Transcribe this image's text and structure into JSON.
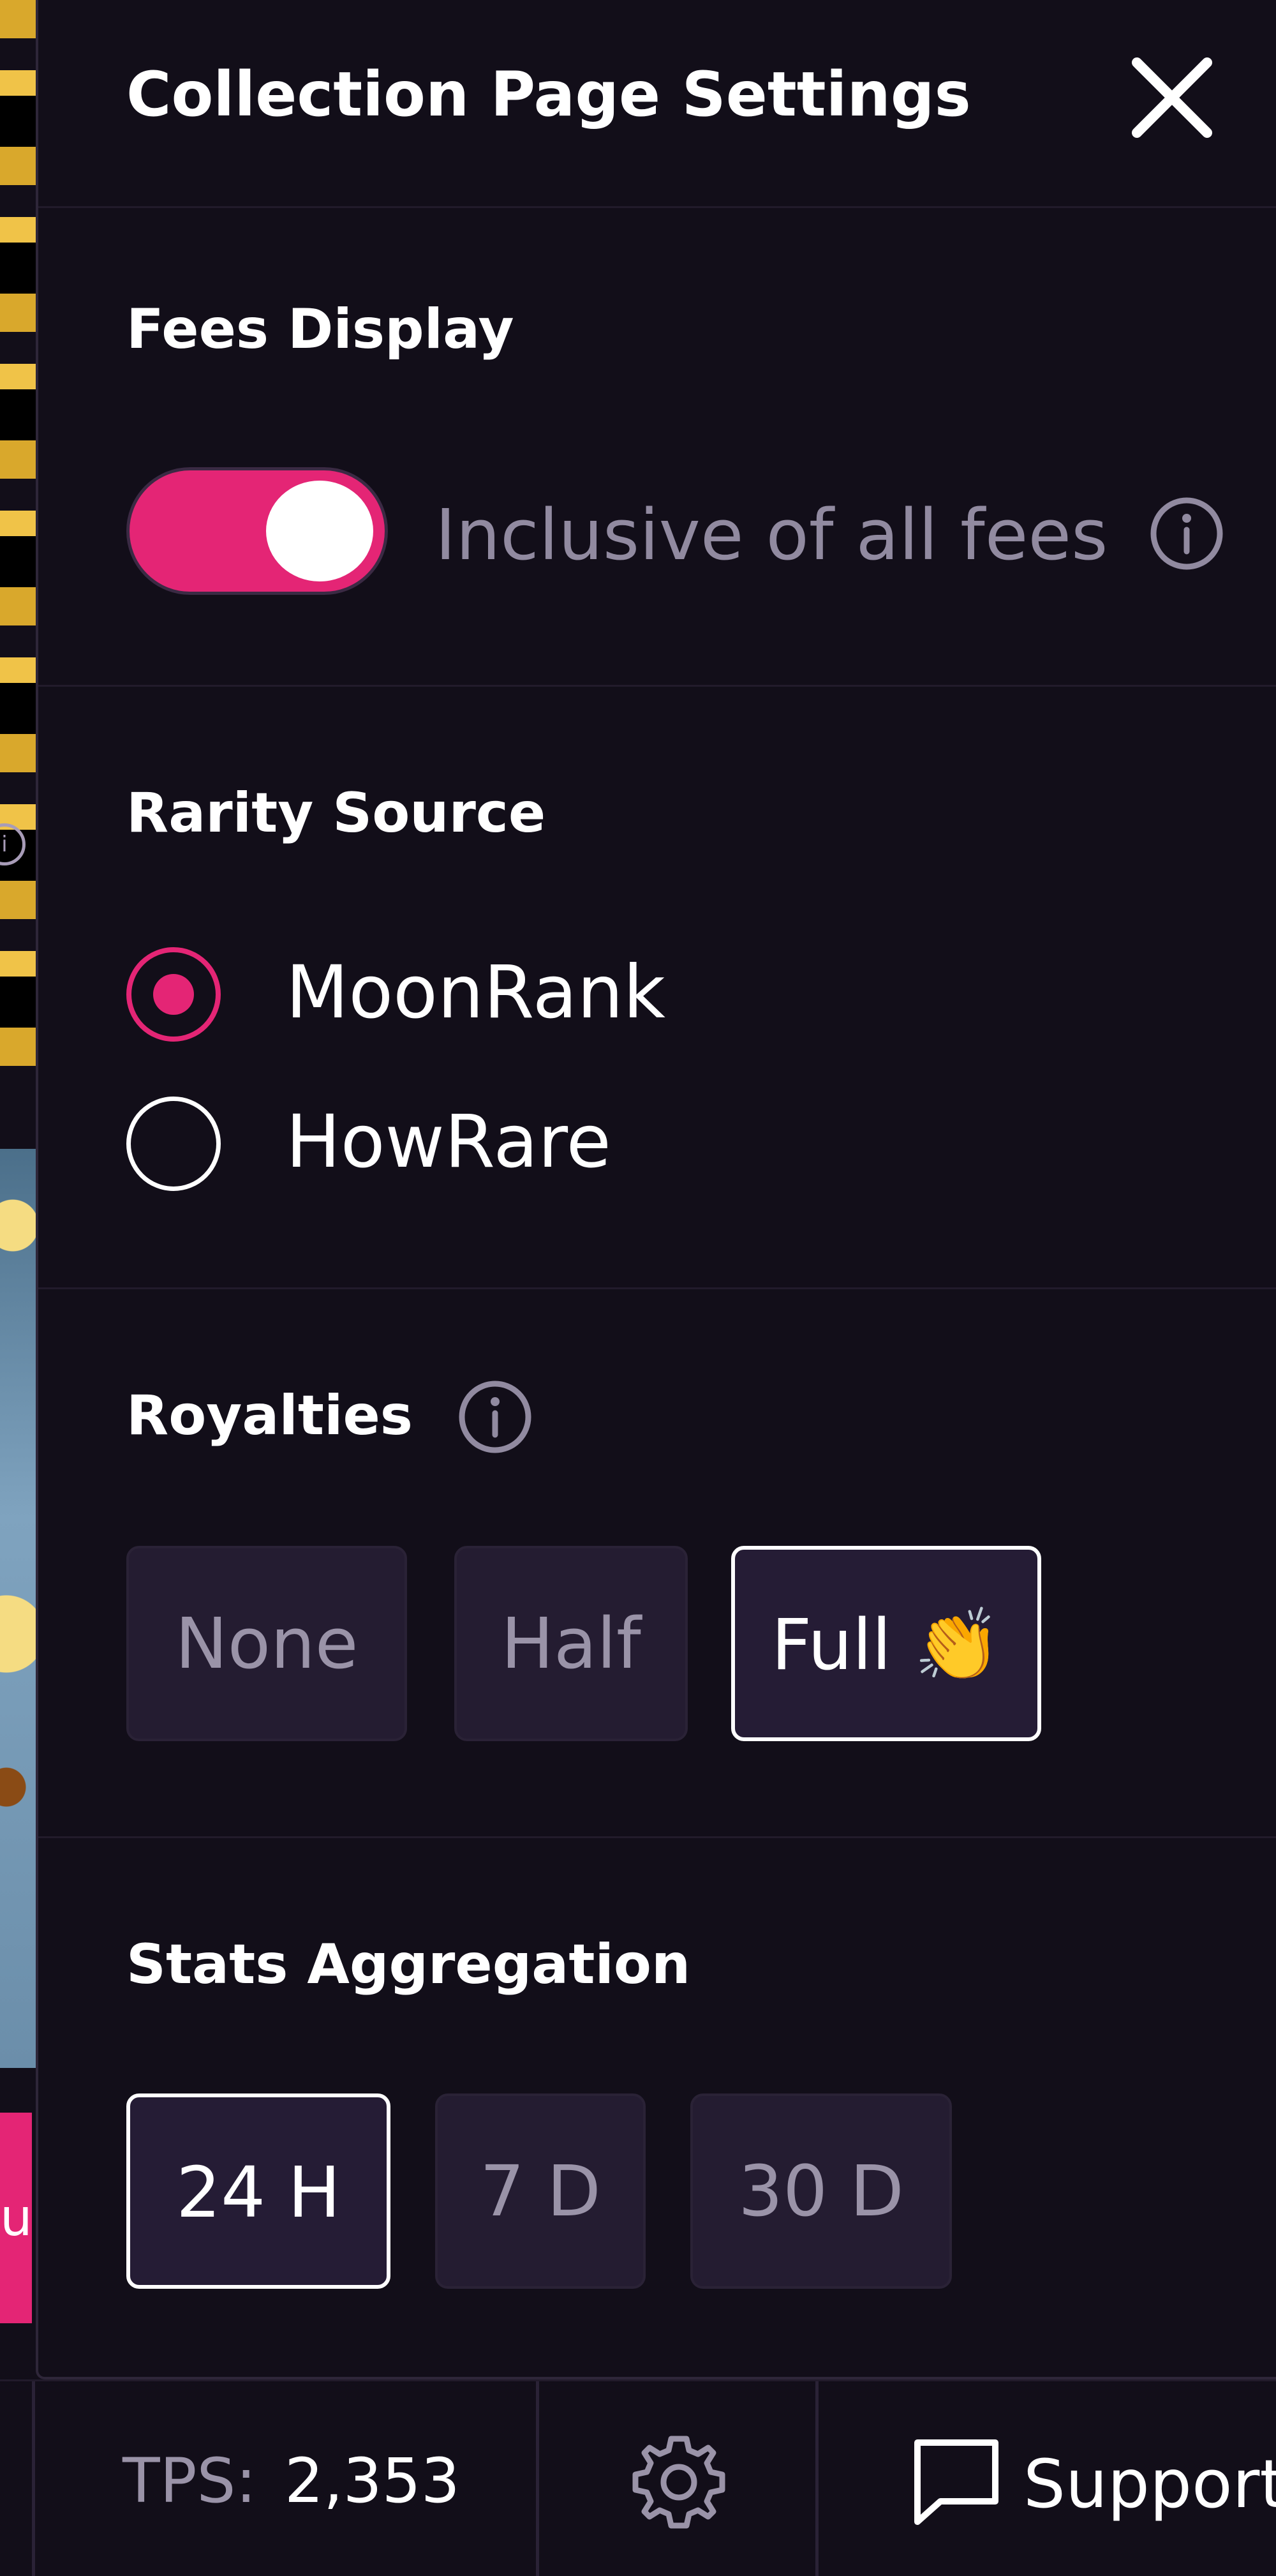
{
  "drawer": {
    "title": "Collection Page Settings"
  },
  "fees_display": {
    "title": "Fees Display",
    "toggle_on": true,
    "label": "Inclusive of all fees"
  },
  "rarity_source": {
    "title": "Rarity Source",
    "options": [
      {
        "label": "MoonRank",
        "selected": true
      },
      {
        "label": "HowRare",
        "selected": false
      }
    ]
  },
  "royalties": {
    "title": "Royalties",
    "options": [
      {
        "label": "None",
        "selected": false
      },
      {
        "label": "Half",
        "selected": false
      },
      {
        "label": "Full 👏",
        "selected": true
      }
    ]
  },
  "stats_aggregation": {
    "title": "Stats Aggregation",
    "options": [
      {
        "label": "24 H",
        "selected": true
      },
      {
        "label": "7 D",
        "selected": false
      },
      {
        "label": "30 D",
        "selected": false
      }
    ]
  },
  "footer": {
    "tps_label": "TPS:",
    "tps_value": "2,353",
    "support_label": "Support"
  },
  "background": {
    "pink_button_glyph": "u"
  },
  "colors": {
    "accent": "#e42575",
    "panel_bg": "#120e19",
    "muted_text": "#918aa0"
  }
}
